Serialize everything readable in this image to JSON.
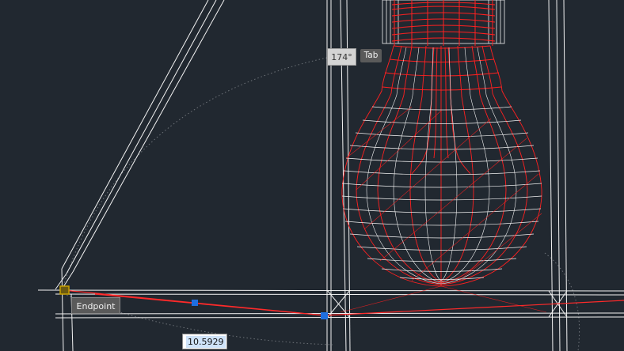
{
  "app": {
    "name": "CAD drawing viewport (wireframe)",
    "background_color": "#212830",
    "wire_color": "#ffffff",
    "bulb_color": "#ff1a1a",
    "grip_color": "#1f6fe0",
    "snap_marker_color": "#c8a000"
  },
  "dynamic_input": {
    "angle_value": "174°",
    "tab_key_hint": "Tab",
    "distance_value": "10.5929"
  },
  "object_snap": {
    "label": "Endpoint"
  },
  "icons": {
    "grip": "grip-square-icon",
    "snap": "endpoint-snap-marker-icon"
  }
}
